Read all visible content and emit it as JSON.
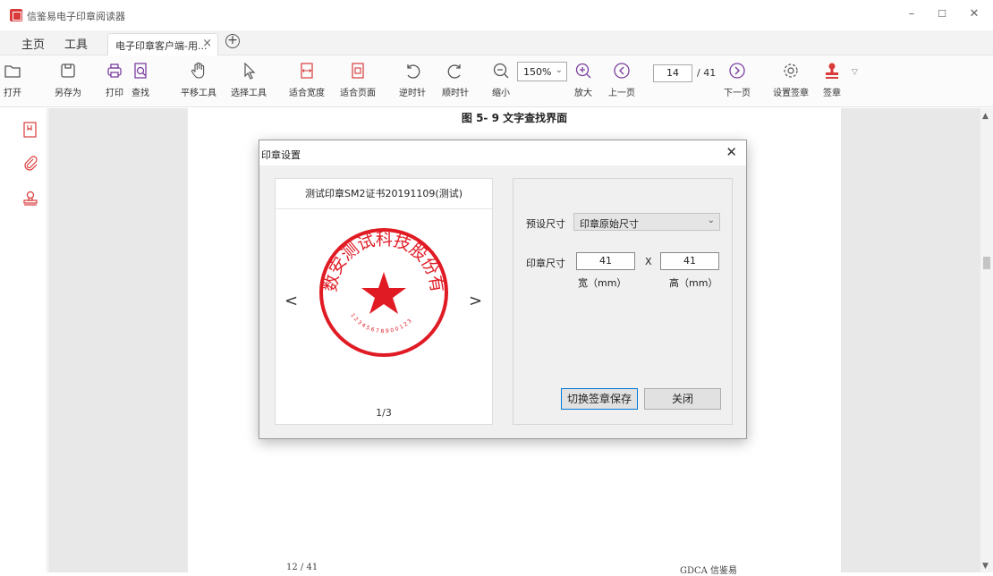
{
  "app": {
    "title": "信鉴易电子印章阅读器",
    "window_controls": [
      "–",
      "☐",
      "✕"
    ]
  },
  "tabs": {
    "home": "主页",
    "tools": "工具",
    "document": "电子印章客户端-用...",
    "close": "×",
    "add": "+"
  },
  "toolbar": {
    "open": "打开",
    "save_as": "另存为",
    "print": "打印",
    "find": "查找",
    "pan_tool": "平移工具",
    "select_tool": "选择工具",
    "fit_width": "适合宽度",
    "fit_page": "适合页面",
    "rotate_ccw": "逆时针",
    "rotate_cw": "顺时针",
    "zoom_out": "缩小",
    "zoom_value": "150%",
    "zoom_in": "放大",
    "prev_page": "上一页",
    "current_page": "14",
    "total_pages": "/ 41",
    "next_page": "下一页",
    "seal_settings": "设置签章",
    "sign": "签章"
  },
  "document": {
    "caption": "图 5- 9 文字查找界面",
    "footer_page": "12 / 41",
    "footer_brand": "GDCA 信鉴易"
  },
  "dialog": {
    "title": "印章设置",
    "close": "✕",
    "seal_name": "测试印章SM2证书20191109(测试)",
    "seal_text": "数安测试科技股份有限公司",
    "seal_bottom_text": "1 2 3 4 5 6 7 8 9 0 0 1 2 3",
    "pager": "1/3",
    "prev": "<",
    "next": ">",
    "preset_label": "预设尺寸",
    "preset_value": "印章原始尺寸",
    "size_label": "印章尺寸",
    "width_value": "41",
    "height_value": "41",
    "times": "X",
    "width_unit": "宽（mm）",
    "height_unit": "高（mm）",
    "switch_save": "切换签章保存",
    "close_btn": "关闭"
  },
  "colors": {
    "seal_red": "#e01b24",
    "accent_blue": "#0078d7",
    "icon_purple": "#7b3fa0",
    "icon_red": "#d93a3a"
  }
}
